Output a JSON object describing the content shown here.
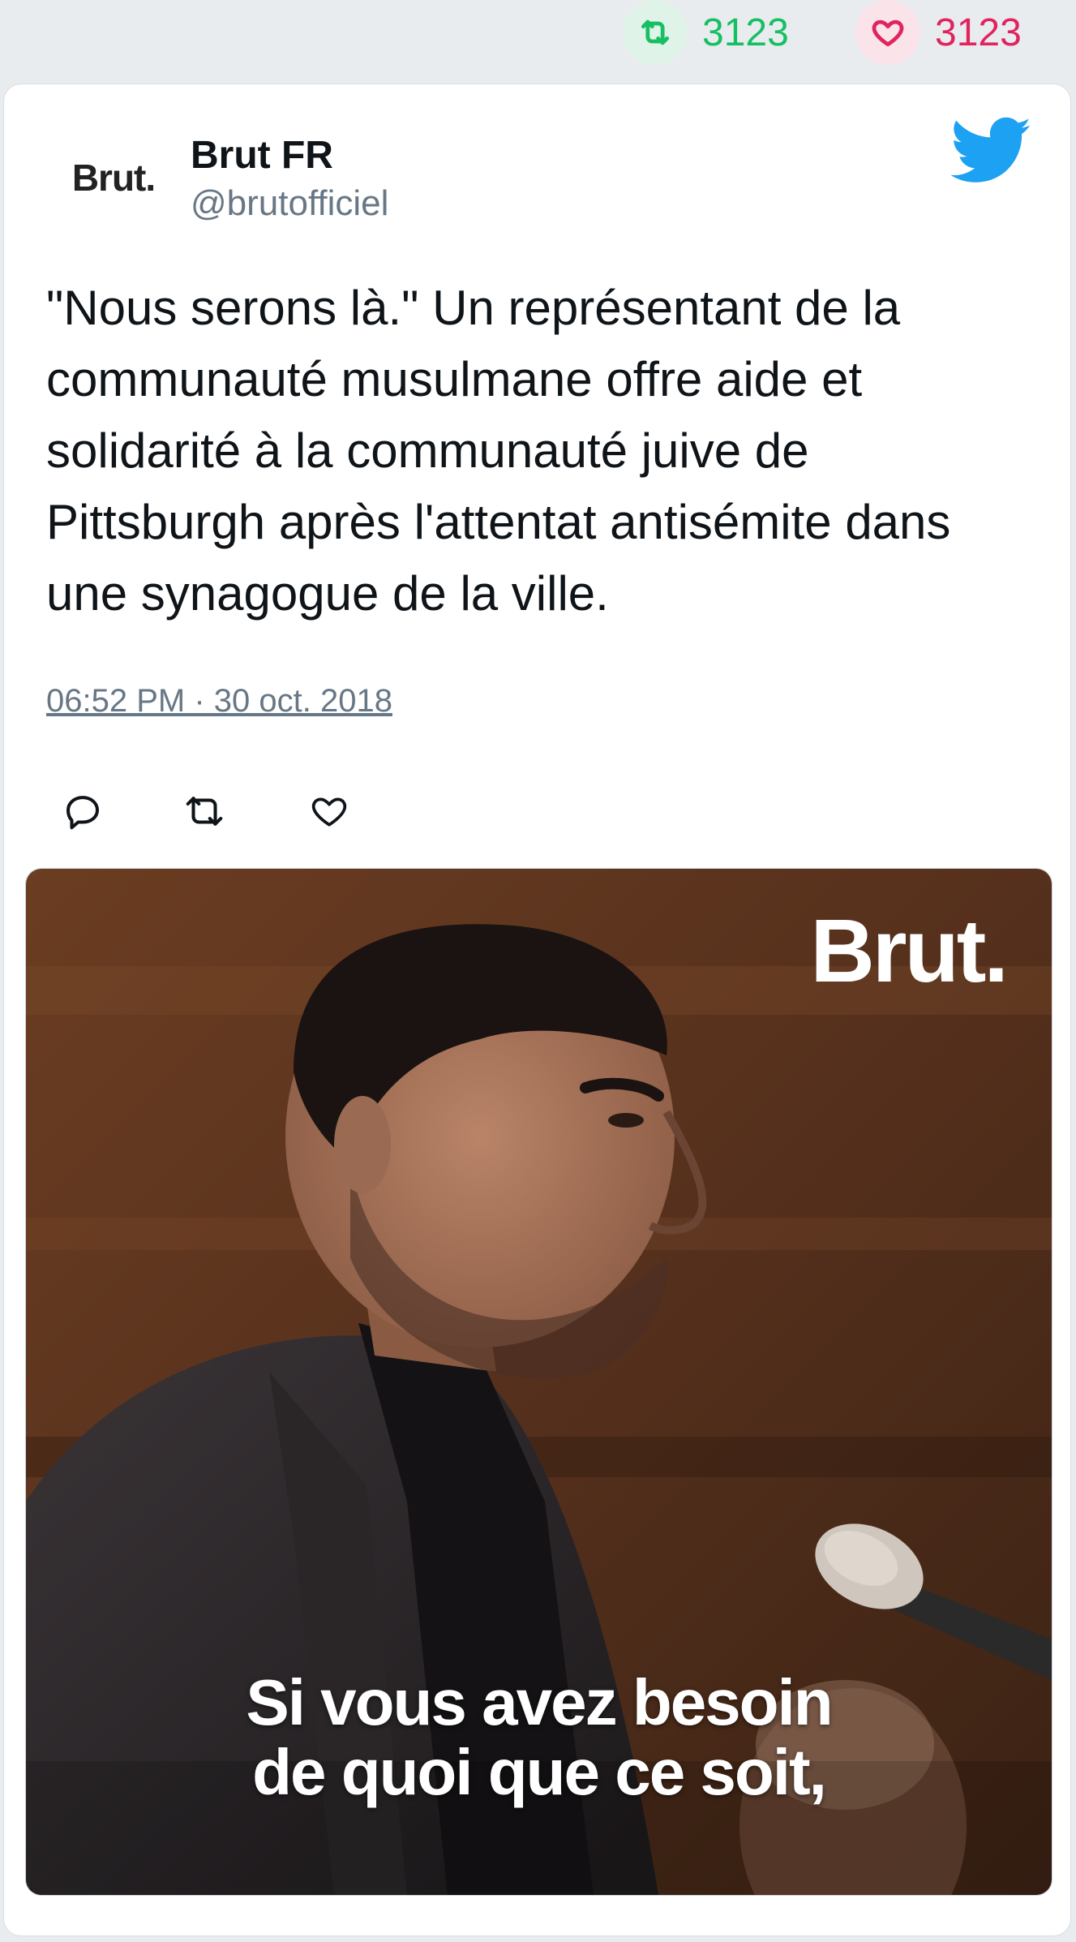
{
  "stats": {
    "retweets": "3123",
    "likes": "3123"
  },
  "tweet": {
    "avatar_text": "Brut.",
    "user_name": "Brut FR",
    "user_handle": "@brutofficiel",
    "text": "\"Nous serons là.\" Un représentant de la communauté musulmane offre aide et solidarité à la communauté juive de Pittsburgh après l'attentat antisémite dans une synagogue de la ville.",
    "timestamp": "06:52 PM · 30 oct. 2018"
  },
  "icons": {
    "brand": "twitter-bird-icon",
    "reply": "reply-icon",
    "retweet": "retweet-icon",
    "like": "heart-icon"
  },
  "media": {
    "brand_overlay": "Brut.",
    "caption_line_1": "Si vous avez besoin",
    "caption_line_2": "de quoi que ce soit,"
  },
  "colors": {
    "retweet_green": "#17bf63",
    "like_red": "#e0245e",
    "twitter_blue": "#1da1f2",
    "handle_gray": "#687785"
  }
}
